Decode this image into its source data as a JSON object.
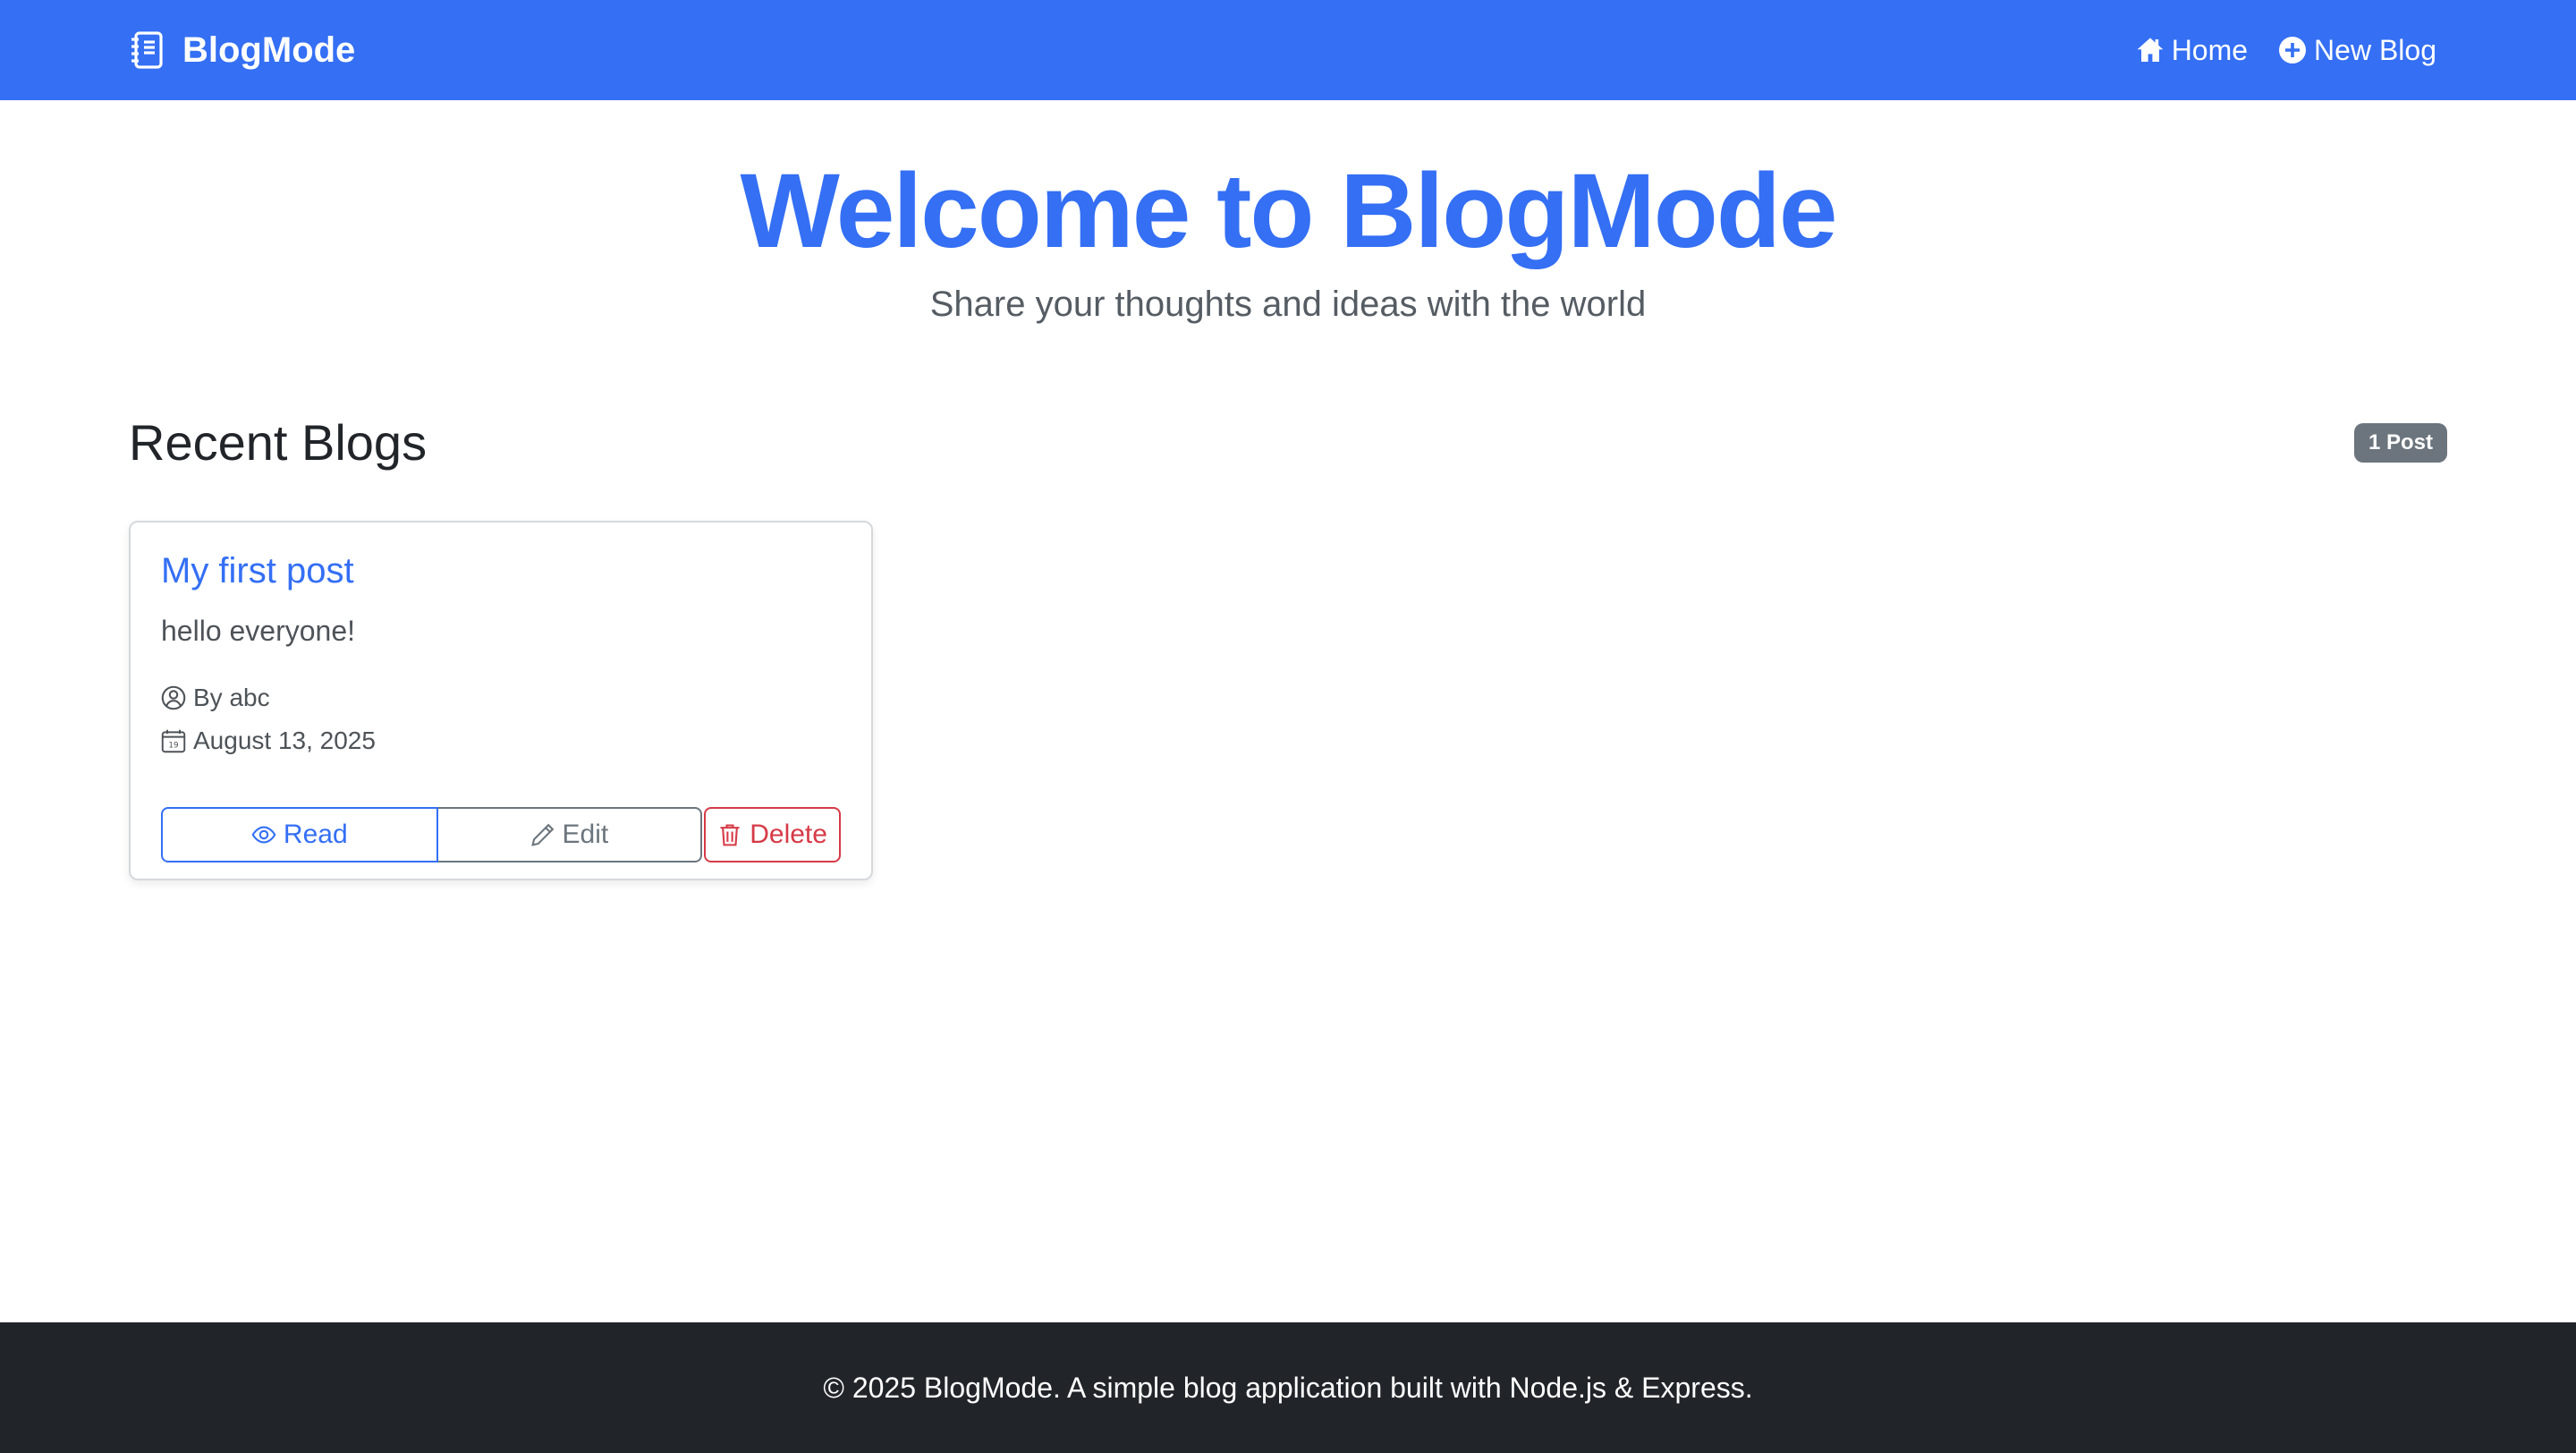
{
  "navbar": {
    "brand": "BlogMode",
    "links": [
      {
        "label": "Home",
        "icon": "house-icon"
      },
      {
        "label": "New Blog",
        "icon": "plus-circle-icon"
      }
    ],
    "color": "#346ff4"
  },
  "hero": {
    "title": "Welcome to BlogMode",
    "subtitle": "Share your thoughts and ideas with the world"
  },
  "section": {
    "title": "Recent Blogs",
    "count_badge": "1 Post"
  },
  "posts": [
    {
      "title": "My first post",
      "excerpt": "hello everyone!",
      "author": "By abc",
      "date": "August 13, 2025",
      "actions": {
        "read": "Read",
        "edit": "Edit",
        "delete": "Delete"
      }
    }
  ],
  "footer": {
    "text": "© 2025 BlogMode. A simple blog application built with Node.js & Express."
  },
  "colors": {
    "primary": "#346ff4",
    "secondary": "#6c757d",
    "danger": "#d63a47",
    "footer_bg": "#212529"
  }
}
